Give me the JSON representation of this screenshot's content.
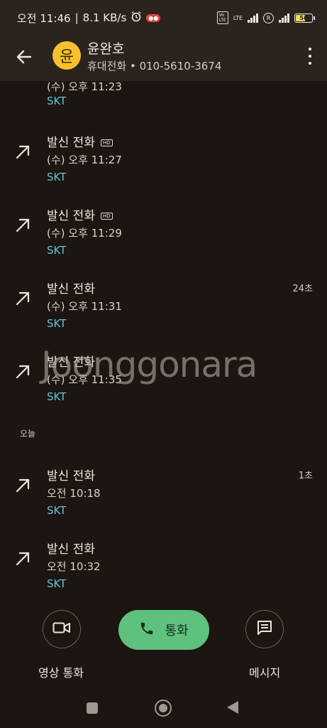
{
  "status_bar": {
    "time": "오전 11:46",
    "net_speed": "8.1 KB/s",
    "battery": "56",
    "lte": "LTE"
  },
  "header": {
    "avatar_letter": "윤",
    "name": "윤완호",
    "subtitle": "휴대전화 • 010-5610-3674"
  },
  "calls": [
    {
      "type": "",
      "time": "(수) 오후 11:23",
      "carrier": "SKT",
      "duration": "",
      "hd": false
    },
    {
      "type": "발신 전화",
      "time": "(수) 오후 11:27",
      "carrier": "SKT",
      "duration": "",
      "hd": true
    },
    {
      "type": "발신 전화",
      "time": "(수) 오후 11:29",
      "carrier": "SKT",
      "duration": "",
      "hd": true
    },
    {
      "type": "발신 전화",
      "time": "(수) 오후 11:31",
      "carrier": "SKT",
      "duration": "24초",
      "hd": false
    },
    {
      "type": "발신 전화",
      "time": "(수) 오후 11:35",
      "carrier": "SKT",
      "duration": "",
      "hd": false
    }
  ],
  "section_today": "오늘",
  "today_calls": [
    {
      "type": "발신 전화",
      "time": "오전 10:18",
      "carrier": "SKT",
      "duration": "1초"
    },
    {
      "type": "발신 전화",
      "time": "오전 10:32",
      "carrier": "SKT",
      "duration": ""
    }
  ],
  "watermark": "Joonggonara",
  "actions": {
    "video_label": "영상 통화",
    "call_label": "통화",
    "message_label": "메시지"
  },
  "icons": {
    "back": "back-arrow-icon",
    "more": "more-vert-icon",
    "outgoing": "outgoing-call-arrow-icon",
    "video": "videocam-icon",
    "phone": "phone-icon",
    "message": "message-icon"
  },
  "colors": {
    "background": "#1c1511",
    "header": "#2b231e",
    "accent_green": "#5ec17d",
    "carrier_blue": "#5fc6d8",
    "avatar": "#f6c02e"
  }
}
